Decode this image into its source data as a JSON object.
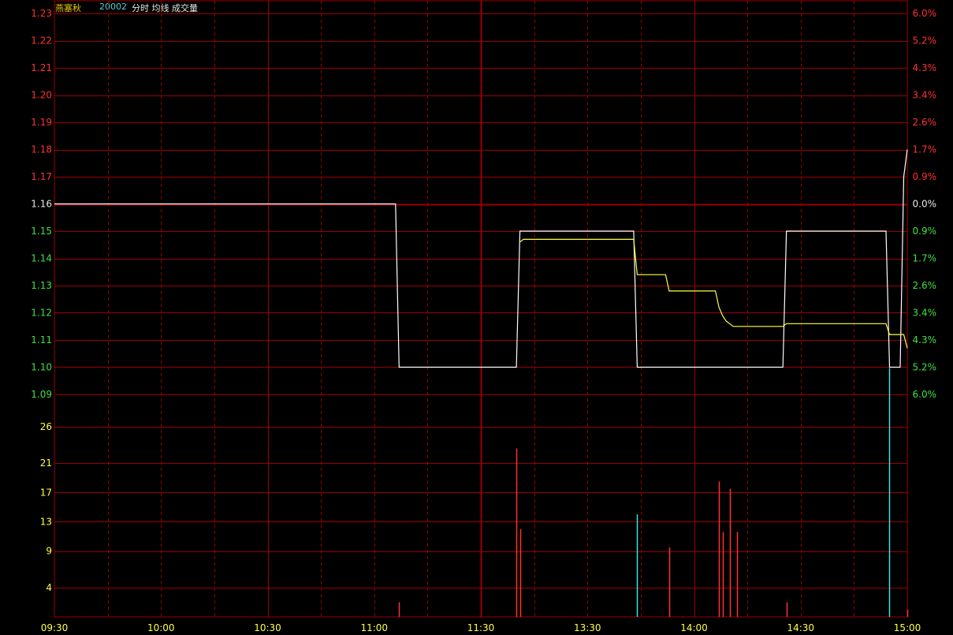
{
  "header": {
    "stock_name": "燕塞秋",
    "stock_code": "20002",
    "indicators": "分时 均线 成交量"
  },
  "colors": {
    "background": "#000000",
    "grid": "#9a0000",
    "up": "#ff3030",
    "down": "#40e040",
    "neutral": "#e6e6e6",
    "price_line": "#ffffff",
    "avg_line": "#ffff40",
    "volume_up": "#ff3030",
    "volume_down": "#40e0e0",
    "volume_axis": "#ffff40",
    "time_axis": "#ffff40"
  },
  "chart_data": [
    {
      "type": "line",
      "name": "intraday-price",
      "time_labels": [
        "09:30",
        "10:00",
        "10:30",
        "11:00",
        "11:30",
        "13:30",
        "14:00",
        "14:30",
        "15:00"
      ],
      "y_ticks_left": [
        "1.23",
        "1.22",
        "1.21",
        "1.20",
        "1.19",
        "1.18",
        "1.17",
        "1.16",
        "1.15",
        "1.14",
        "1.13",
        "1.12",
        "1.11",
        "1.10",
        "1.09"
      ],
      "y_ticks_right": [
        "6.0%",
        "5.2%",
        "4.3%",
        "3.4%",
        "2.6%",
        "1.7%",
        "0.9%",
        "0.0%",
        "0.9%",
        "1.7%",
        "2.6%",
        "3.4%",
        "4.3%",
        "5.2%",
        "6.0%"
      ],
      "ylim": [
        1.09,
        1.23
      ],
      "prev_close": 1.16,
      "xlim_minutes": [
        0,
        240
      ],
      "series": [
        {
          "name": "price",
          "points": [
            [
              0,
              1.16
            ],
            [
              96,
              1.16
            ],
            [
              97,
              1.1
            ],
            [
              130,
              1.1
            ],
            [
              131,
              1.15
            ],
            [
              163,
              1.15
            ],
            [
              164,
              1.1
            ],
            [
              205,
              1.1
            ],
            [
              206,
              1.15
            ],
            [
              234,
              1.15
            ],
            [
              235,
              1.1
            ],
            [
              238,
              1.1
            ],
            [
              239,
              1.17
            ],
            [
              240,
              1.18
            ]
          ]
        },
        {
          "name": "average",
          "points": [
            [
              131,
              1.146
            ],
            [
              132,
              1.147
            ],
            [
              163,
              1.147
            ],
            [
              164,
              1.134
            ],
            [
              172,
              1.134
            ],
            [
              173,
              1.128
            ],
            [
              186,
              1.128
            ],
            [
              187,
              1.122
            ],
            [
              188,
              1.119
            ],
            [
              189,
              1.117
            ],
            [
              190,
              1.116
            ],
            [
              191,
              1.115
            ],
            [
              205,
              1.115
            ],
            [
              206,
              1.116
            ],
            [
              234,
              1.116
            ],
            [
              235,
              1.112
            ],
            [
              239,
              1.112
            ],
            [
              240,
              1.107
            ]
          ]
        }
      ]
    },
    {
      "type": "bar",
      "name": "volume",
      "y_ticks": [
        "26",
        "21",
        "17",
        "13",
        "9",
        "4"
      ],
      "ylim": [
        0,
        30.4
      ],
      "bars": [
        {
          "t": 97,
          "v": 2,
          "dir": "up"
        },
        {
          "t": 130,
          "v": 23,
          "dir": "up"
        },
        {
          "t": 131,
          "v": 12,
          "dir": "up"
        },
        {
          "t": 164,
          "v": 14,
          "dir": "down"
        },
        {
          "t": 173,
          "v": 9.5,
          "dir": "up"
        },
        {
          "t": 187,
          "v": 18.5,
          "dir": "up"
        },
        {
          "t": 188,
          "v": 11.6,
          "dir": "up"
        },
        {
          "t": 190,
          "v": 17.5,
          "dir": "up"
        },
        {
          "t": 192,
          "v": 11.6,
          "dir": "up"
        },
        {
          "t": 206,
          "v": 2,
          "dir": "up"
        },
        {
          "t": 235,
          "v": 34,
          "dir": "down"
        },
        {
          "t": 240,
          "v": 1,
          "dir": "up"
        }
      ]
    }
  ]
}
